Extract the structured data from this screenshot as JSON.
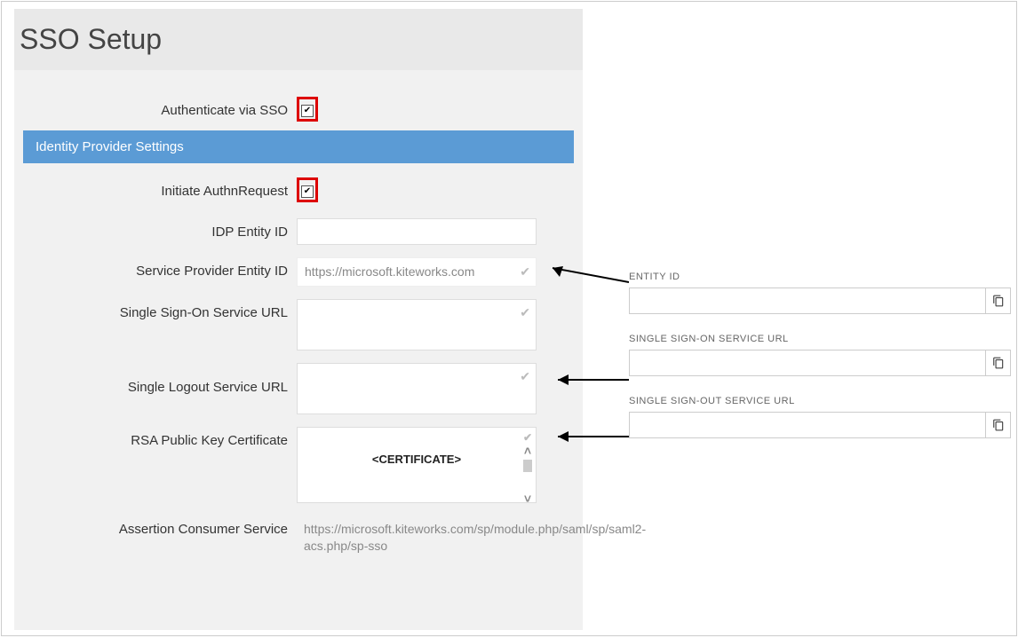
{
  "title": "SSO Setup",
  "auth_label": "Authenticate via SSO",
  "idp_section": "Identity Provider Settings",
  "initiate_label": "Initiate AuthnRequest",
  "fields": {
    "idp_entity_label": "IDP Entity ID",
    "idp_entity_value": "",
    "sp_entity_label": "Service Provider Entity ID",
    "sp_entity_value": "https://microsoft.kiteworks.com",
    "sso_url_label": "Single Sign-On Service URL",
    "sso_url_value": "",
    "slo_url_label": "Single Logout Service URL",
    "slo_url_value": "",
    "rsa_label": "RSA Public Key Certificate",
    "rsa_value": "<CERTIFICATE>",
    "acs_label": "Assertion Consumer Service",
    "acs_value": "https://microsoft.kiteworks.com/sp/module.php/saml/sp/saml2-acs.php/sp-sso"
  },
  "ref": {
    "entity_label": "ENTITY ID",
    "sso_label": "SINGLE SIGN-ON SERVICE URL",
    "slo_label": "SINGLE SIGN-OUT SERVICE URL"
  }
}
